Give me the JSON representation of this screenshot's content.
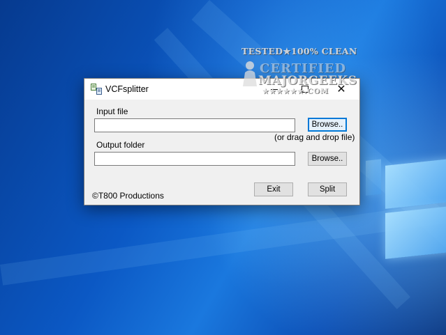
{
  "window": {
    "title": "VCFsplitter",
    "controls": {
      "minimize": "–",
      "maximize": "□",
      "close": "✕"
    }
  },
  "form": {
    "input_file_label": "Input file",
    "input_file_value": "",
    "input_browse_label": "Browse..",
    "drag_hint": "(or drag and drop file)",
    "output_folder_label": "Output folder",
    "output_folder_value": "",
    "output_browse_label": "Browse..",
    "exit_label": "Exit",
    "split_label": "Split",
    "copyright": "©T800 Productions"
  },
  "watermark": {
    "line1": "TESTED★100% CLEAN",
    "line2": "CERTIFIED",
    "line3": "MAJORGEEKS",
    "line4": "★★★★★★.COM"
  },
  "colors": {
    "desktop": "#0b58c4",
    "window_bg": "#f0f0f0",
    "focus_border": "#0078d7"
  },
  "icons": {
    "app": "vcf-app-icon",
    "close": "close-icon",
    "minimize": "minimize-icon",
    "maximize": "maximize-icon"
  }
}
